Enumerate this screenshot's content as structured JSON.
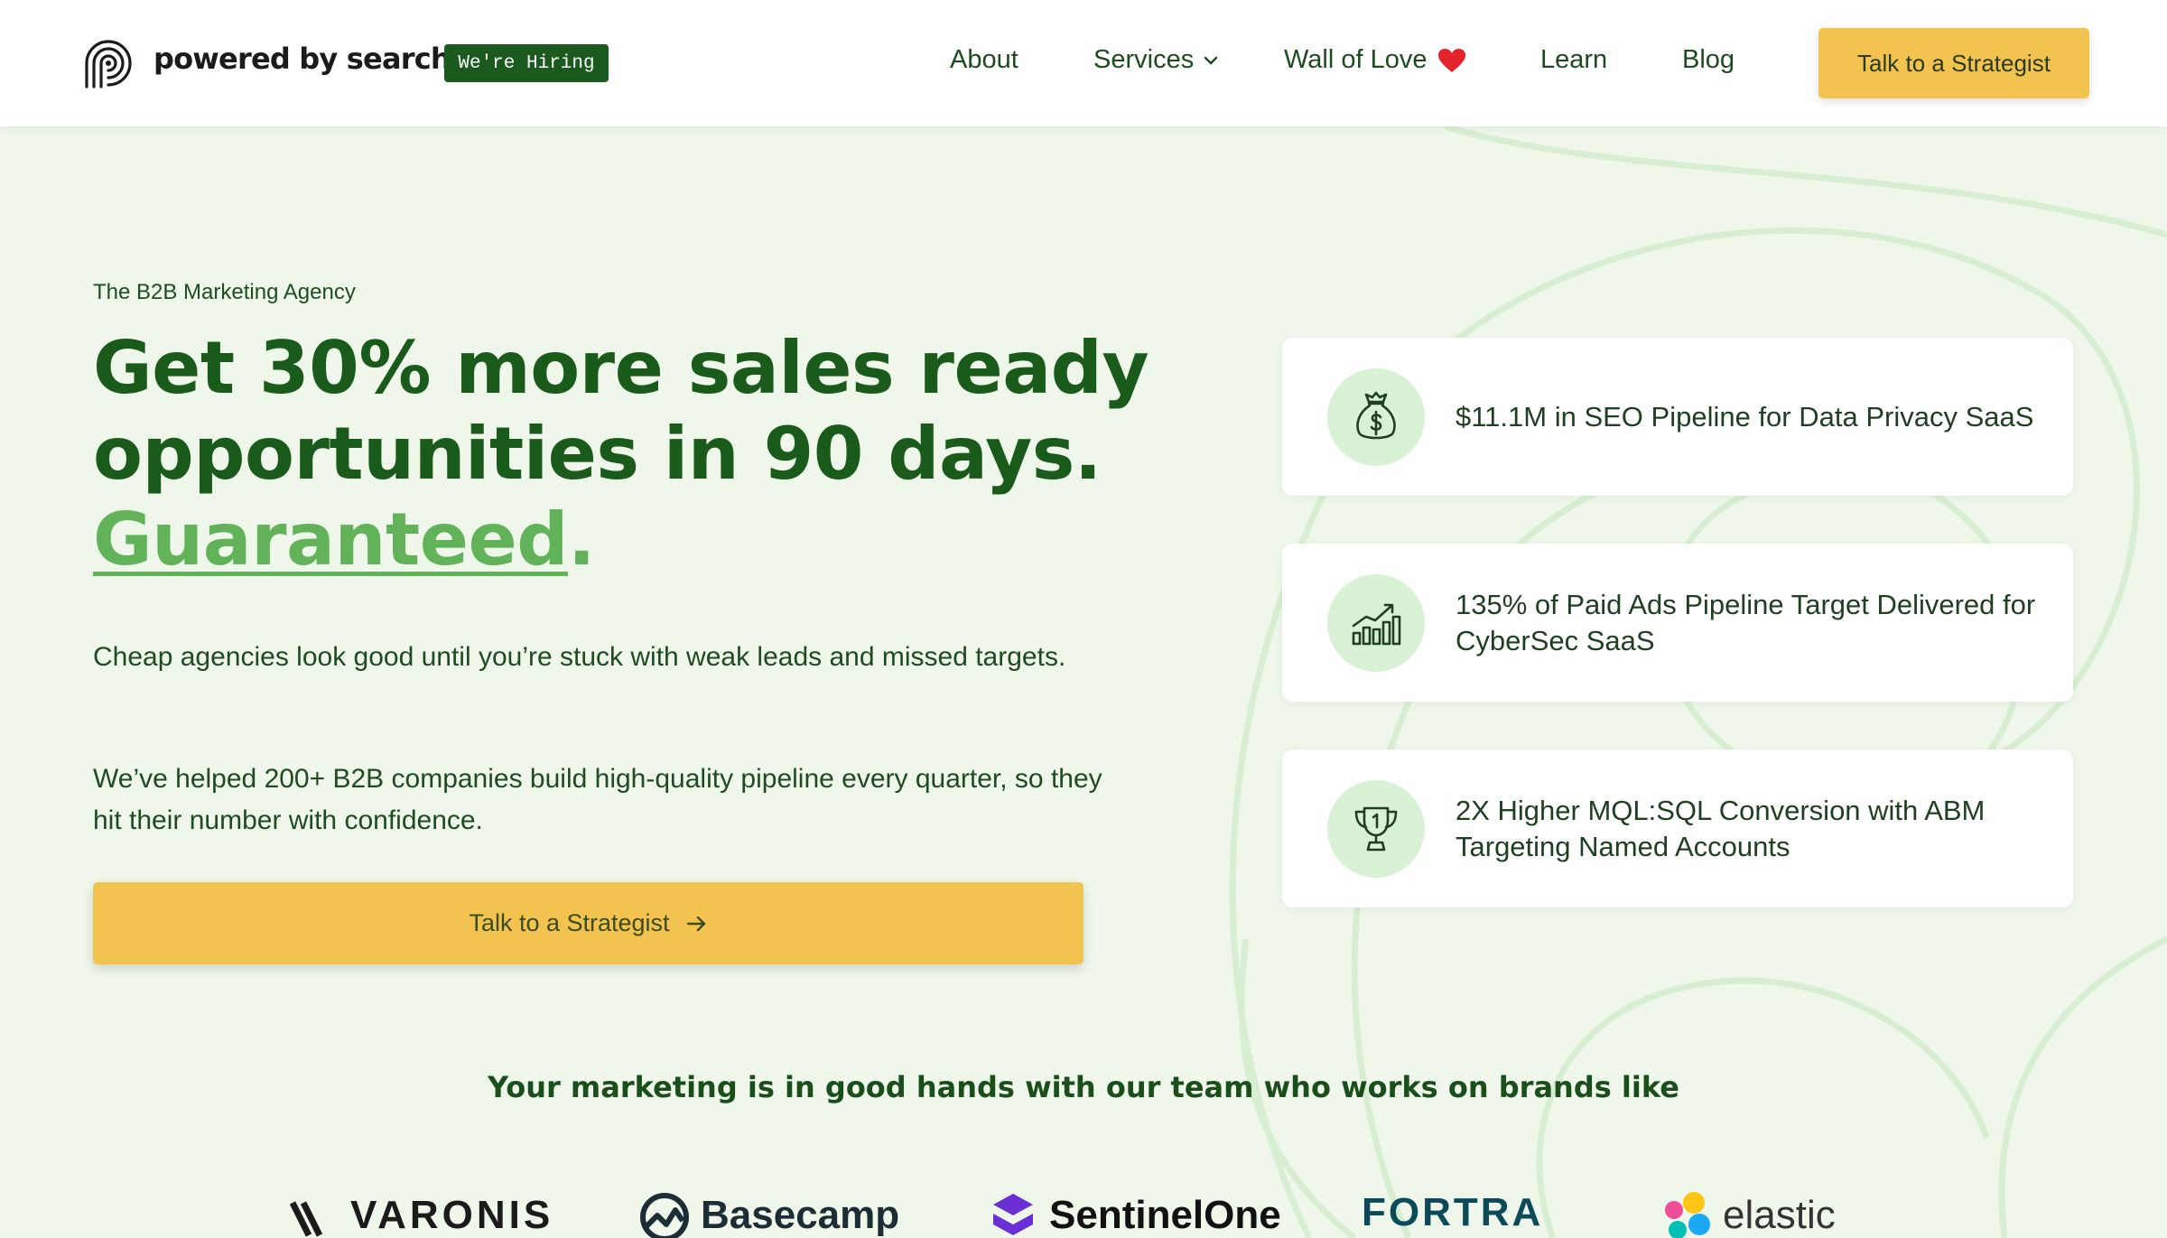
{
  "header": {
    "brand": "powered by search",
    "hiring_badge": "We're Hiring",
    "nav": [
      {
        "label": "About"
      },
      {
        "label": "Services"
      },
      {
        "label": "Wall of Love"
      },
      {
        "label": "Learn"
      },
      {
        "label": "Blog"
      }
    ],
    "cta": "Talk to a Strategist"
  },
  "hero": {
    "eyebrow": "The B2B Marketing Agency",
    "headline_line1": "Get 30% more sales ready",
    "headline_line2": "opportunities in 90 days.",
    "headline_emphasis": "Guaranteed",
    "headline_punct": ".",
    "paragraph1": "Cheap agencies look good until you’re stuck with weak leads and missed targets.",
    "paragraph2": "We’ve helped 200+ B2B companies build high-quality pipeline every quarter, so they hit their number with confidence.",
    "cta": "Talk to a Strategist"
  },
  "stats": [
    {
      "text": "$11.1M in SEO Pipeline for Data Privacy SaaS",
      "icon": "money-bag-icon"
    },
    {
      "text": "135% of Paid Ads Pipeline Target Delivered for CyberSec SaaS",
      "icon": "growth-chart-icon"
    },
    {
      "text": "2X Higher MQL:SQL Conversion with ABM Targeting Named Accounts",
      "icon": "trophy-icon"
    }
  ],
  "brands": {
    "title": "Your marketing is in good hands with our team who works on brands like",
    "logos": [
      "VARONIS",
      "Basecamp",
      "SentinelOne",
      "FORTRA",
      "elastic"
    ]
  },
  "colors": {
    "accent_yellow": "#f2c44f",
    "brand_green": "#1b5a1e",
    "highlight_green": "#62b25a",
    "background": "#eef7ea"
  }
}
